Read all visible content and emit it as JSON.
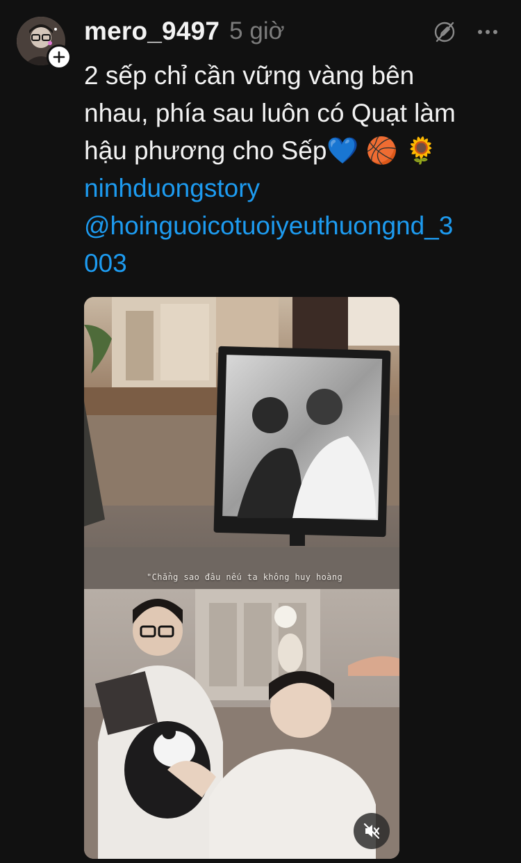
{
  "post": {
    "username": "mero_9497",
    "timestamp": "5 giờ",
    "caption_lines": [
      "2 sếp chỉ cần vững vàng bên",
      "nhau, phía sau luôn có Quạt làm",
      "hậu phương cho Sếp💙 🏀 🌻"
    ],
    "links": [
      "ninhduongstory",
      "@hoinguoicotuoiyeuthuongnd_3",
      "003"
    ],
    "video_caption": "\"Chẳng sao đâu nếu ta không huy hoàng"
  },
  "icons": {
    "follow": "plus-icon",
    "action_1": "edit-disabled-icon",
    "action_2": "more-icon",
    "mute": "speaker-muted-icon"
  },
  "colors": {
    "background": "#111111",
    "text": "#f3f3f3",
    "muted_text": "#7c7c7c",
    "link": "#1d9bf0"
  }
}
